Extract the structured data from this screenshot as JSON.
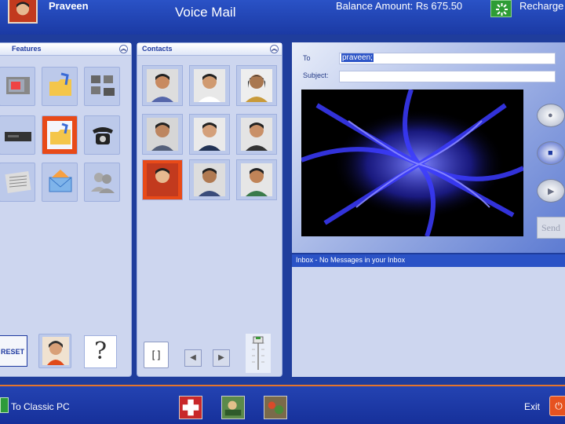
{
  "header": {
    "user_name": "Praveen",
    "app_title": "Voice Mail",
    "balance": "Balance Amount: Rs 675.50",
    "recharge_label": "Recharge"
  },
  "features_panel": {
    "title": "Features",
    "icons": [
      "tv-icon",
      "folder-music-icon",
      "video-conference-icon",
      "vcr-icon",
      "folder-voice-icon",
      "telephone-icon",
      "newspaper-icon",
      "envelope-icon",
      "users-icon"
    ],
    "reset_label": "RESET",
    "help_symbol": "?"
  },
  "contacts_panel": {
    "title": "Contacts",
    "toggle_symbol": "[ ]",
    "prev_symbol": "◀",
    "next_symbol": "▶"
  },
  "compose": {
    "to_label": "To",
    "to_value": "praveen;",
    "subject_label": "Subject:",
    "subject_value": "",
    "send_label": "Send"
  },
  "inbox": {
    "status": "Inbox - No Messages in your Inbox"
  },
  "footer": {
    "classic_label": "To Classic PC",
    "exit_label": "Exit"
  },
  "colors": {
    "accent": "#1f3d9c",
    "selected": "#e84a18",
    "panel": "#cdd6ef"
  }
}
